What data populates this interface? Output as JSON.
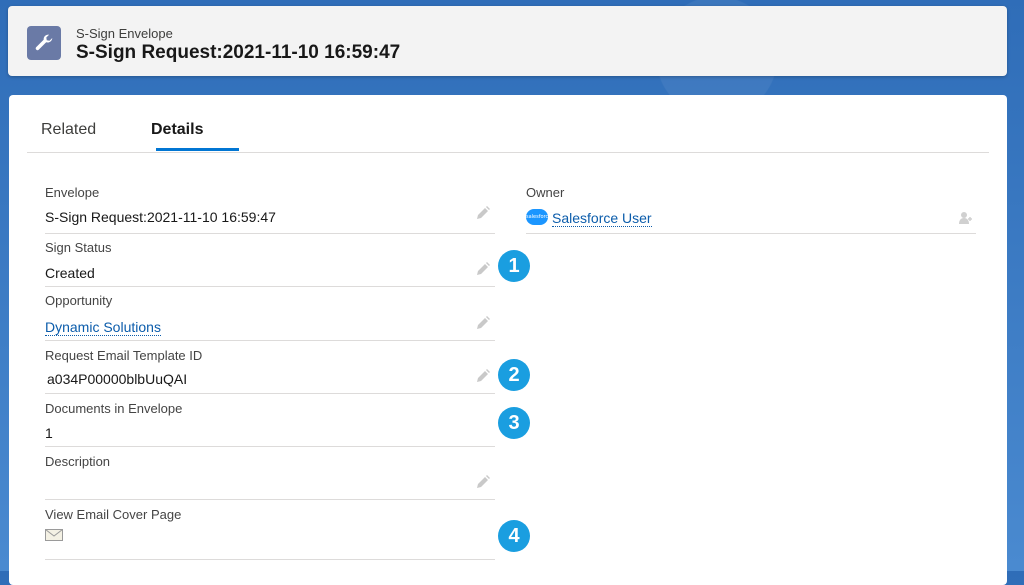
{
  "header": {
    "object_type": "S-Sign Envelope",
    "record_title": "S-Sign Request:2021-11-10 16:59:47",
    "icon": "wrench-icon"
  },
  "tabs": [
    {
      "label": "Related",
      "active": false
    },
    {
      "label": "Details",
      "active": true
    }
  ],
  "fields": {
    "envelope": {
      "label": "Envelope",
      "value": "S-Sign Request:2021-11-10 16:59:47"
    },
    "sign_status": {
      "label": "Sign Status",
      "value": "Created"
    },
    "opportunity": {
      "label": "Opportunity",
      "value": "Dynamic Solutions"
    },
    "request_email_template_id": {
      "label": "Request Email Template ID",
      "value": "a034P00000blbUuQAI"
    },
    "documents_in_envelope": {
      "label": "Documents in Envelope",
      "value": "1"
    },
    "description": {
      "label": "Description",
      "value": ""
    },
    "view_email_cover_page": {
      "label": "View Email Cover Page",
      "icon": "envelope-icon"
    },
    "owner": {
      "label": "Owner",
      "value": "Salesforce User",
      "logo_text": "salesforce"
    }
  },
  "callouts": [
    "1",
    "2",
    "3",
    "4"
  ],
  "colors": {
    "accent": "#0176d3",
    "link": "#0b5cab",
    "callout": "#1a9ee0",
    "object_icon": "#6a7aa6"
  }
}
